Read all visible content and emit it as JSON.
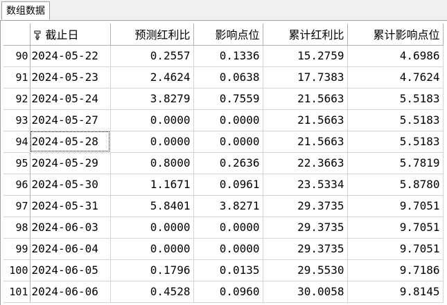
{
  "tab": {
    "label": "数组数据"
  },
  "columns": {
    "date": "截止日",
    "pred": "预测红利比",
    "impact": "影响点位",
    "cum_pred": "累计红利比",
    "cum_impact": "累计影响点位"
  },
  "rows": [
    {
      "n": "90",
      "date": "2024-05-22",
      "pred": "0.2557",
      "impact": "0.1336",
      "cum_pred": "15.2759",
      "cum_impact": "4.6986"
    },
    {
      "n": "91",
      "date": "2024-05-23",
      "pred": "2.4624",
      "impact": "0.0638",
      "cum_pred": "17.7383",
      "cum_impact": "4.7624"
    },
    {
      "n": "92",
      "date": "2024-05-24",
      "pred": "3.8279",
      "impact": "0.7559",
      "cum_pred": "21.5663",
      "cum_impact": "5.5183"
    },
    {
      "n": "93",
      "date": "2024-05-27",
      "pred": "0.0000",
      "impact": "0.0000",
      "cum_pred": "21.5663",
      "cum_impact": "5.5183"
    },
    {
      "n": "94",
      "date": "2024-05-28",
      "pred": "0.0000",
      "impact": "0.0000",
      "cum_pred": "21.5663",
      "cum_impact": "5.5183"
    },
    {
      "n": "95",
      "date": "2024-05-29",
      "pred": "0.8000",
      "impact": "0.2636",
      "cum_pred": "22.3663",
      "cum_impact": "5.7819"
    },
    {
      "n": "96",
      "date": "2024-05-30",
      "pred": "1.1671",
      "impact": "0.0961",
      "cum_pred": "23.5334",
      "cum_impact": "5.8780"
    },
    {
      "n": "97",
      "date": "2024-05-31",
      "pred": "5.8401",
      "impact": "3.8271",
      "cum_pred": "29.3735",
      "cum_impact": "9.7051"
    },
    {
      "n": "98",
      "date": "2024-06-03",
      "pred": "0.0000",
      "impact": "0.0000",
      "cum_pred": "29.3735",
      "cum_impact": "9.7051"
    },
    {
      "n": "99",
      "date": "2024-06-04",
      "pred": "0.0000",
      "impact": "0.0000",
      "cum_pred": "29.3735",
      "cum_impact": "9.7051"
    },
    {
      "n": "100",
      "date": "2024-06-05",
      "pred": "0.1796",
      "impact": "0.0135",
      "cum_pred": "29.5530",
      "cum_impact": "9.7186"
    },
    {
      "n": "101",
      "date": "2024-06-06",
      "pred": "0.4528",
      "impact": "0.0960",
      "cum_pred": "30.0058",
      "cum_impact": "9.8145"
    }
  ],
  "focused_row_index": 4,
  "icons": {
    "sort": "sort-icon"
  }
}
